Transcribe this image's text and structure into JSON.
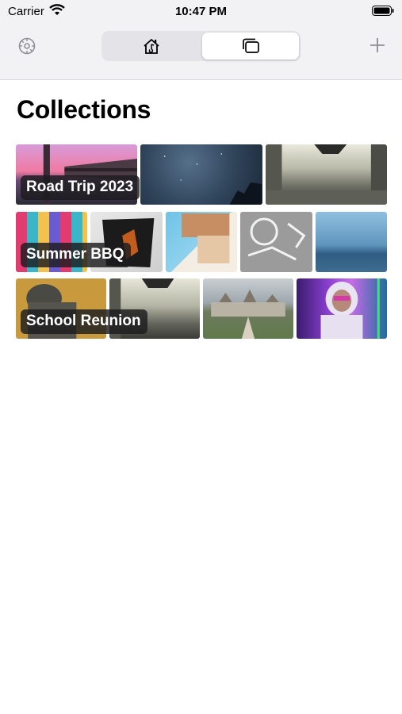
{
  "status_bar": {
    "carrier": "Carrier",
    "time": "10:47 PM"
  },
  "nav": {
    "settings_icon": "gear-icon",
    "add_icon": "plus-icon",
    "segments": [
      {
        "icon": "home-icon",
        "selected": false
      },
      {
        "icon": "collections-icon",
        "selected": true
      }
    ]
  },
  "page_title": "Collections",
  "collections": [
    {
      "name": "Road Trip 2023",
      "photos": 3
    },
    {
      "name": "Summer BBQ",
      "photos": 5
    },
    {
      "name": "School Reunion",
      "photos": 4
    }
  ]
}
